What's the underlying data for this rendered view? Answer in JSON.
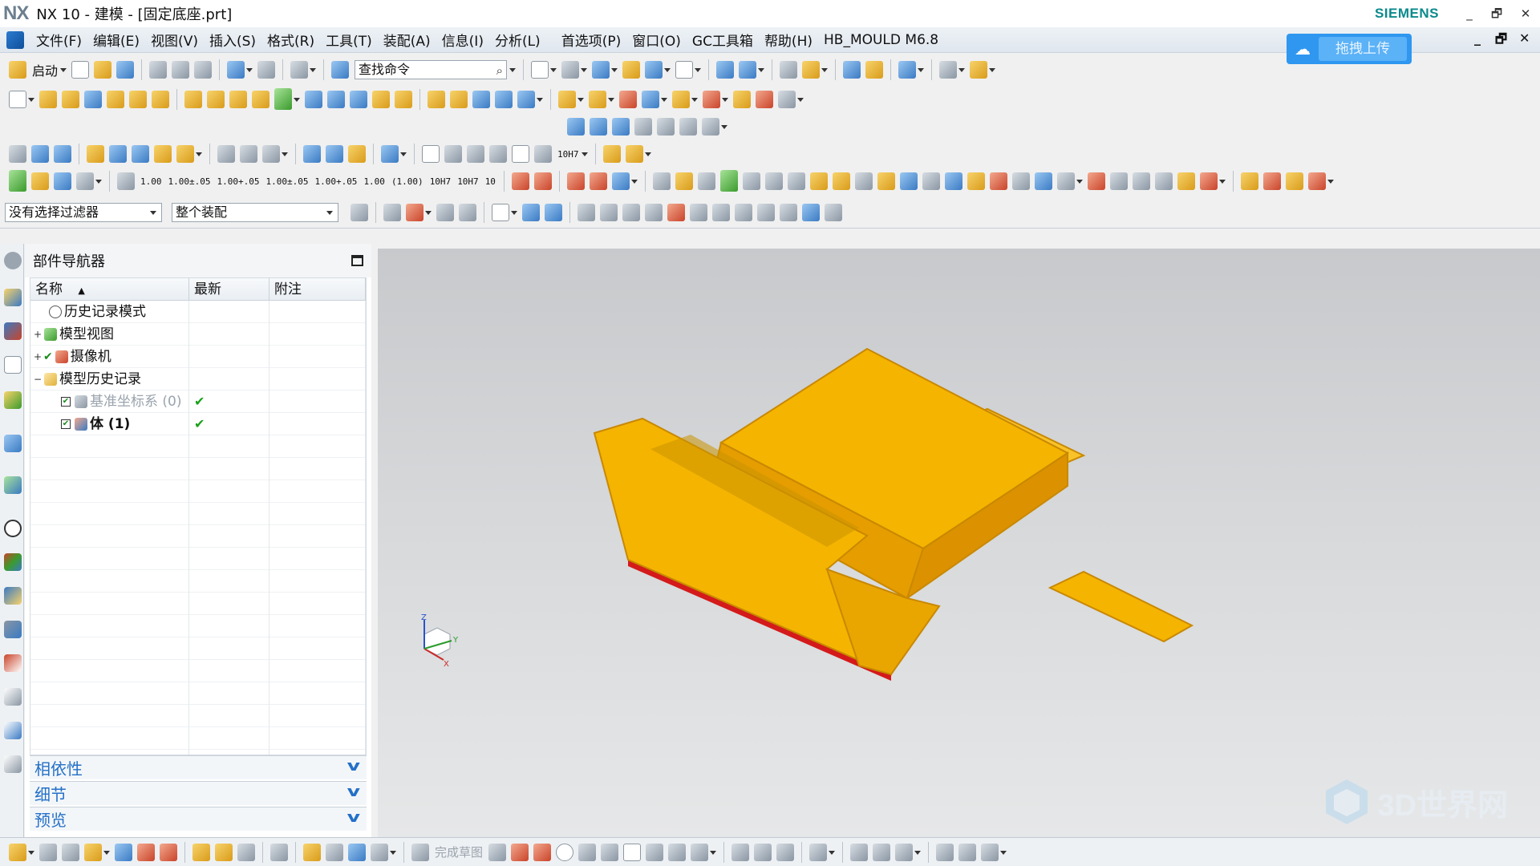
{
  "window": {
    "logo": "NX",
    "title": "NX 10 - 建模 - [固定底座.prt]",
    "brand": "SIEMENS",
    "controls": {
      "minimize": "_",
      "restore": "🗗",
      "close": "✕"
    }
  },
  "menubar": {
    "items": [
      "文件(F)",
      "编辑(E)",
      "视图(V)",
      "插入(S)",
      "格式(R)",
      "工具(T)",
      "装配(A)",
      "信息(I)",
      "分析(L)",
      "首选项(P)",
      "窗口(O)",
      "GC工具箱",
      "帮助(H)",
      "HB_MOULD M6.8"
    ],
    "mdi": {
      "minimize": "_",
      "restore": "🗗",
      "close": "✕"
    }
  },
  "upload_badge": {
    "label": "拖拽上传"
  },
  "toolbar": {
    "start_label": "启动",
    "search_placeholder": "查找命令",
    "numeric_buttons": [
      "1.00",
      "1.00±.05",
      "1.00+.05",
      "1.00±.05",
      "1.00+.05",
      "1.00",
      "(1.00)",
      "10H7",
      "10H7",
      "10H7",
      "10"
    ]
  },
  "filter_bar": {
    "selection_filter": "没有选择过滤器",
    "scope": "整个装配"
  },
  "navigator": {
    "title": "部件导航器",
    "columns": [
      "名称",
      "最新",
      "附注"
    ],
    "rows": [
      {
        "expander": "",
        "label": "历史记录模式",
        "latest": "",
        "greyed": false,
        "bold": false
      },
      {
        "expander": "+",
        "label": "模型视图",
        "latest": "",
        "greyed": false,
        "bold": false
      },
      {
        "expander": "+",
        "label": "摄像机",
        "latest": "",
        "greyed": false,
        "bold": false
      },
      {
        "expander": "−",
        "label": "模型历史记录",
        "latest": "",
        "greyed": false,
        "bold": false
      },
      {
        "expander": "",
        "label": "基准坐标系 (0)",
        "latest": "✔",
        "greyed": true,
        "bold": false
      },
      {
        "expander": "",
        "label": "体 (1)",
        "latest": "✔",
        "greyed": false,
        "bold": true
      }
    ],
    "panels": [
      "相依性",
      "细节",
      "预览"
    ]
  },
  "viewport": {
    "model_color": "#f5b400",
    "model_shadow": "#d98a00",
    "edge_color": "#d41a1a",
    "triad": {
      "z": "Z",
      "x": "X",
      "y": "Y"
    },
    "watermark": "3D世界网"
  },
  "statusbar": {
    "sketch_label": "完成草图"
  }
}
